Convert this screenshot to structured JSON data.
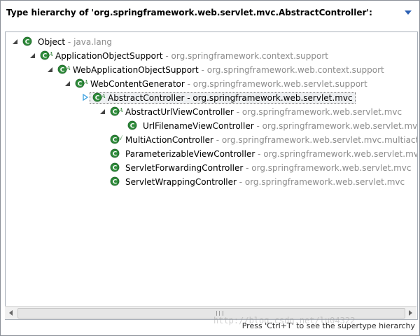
{
  "header": {
    "title": "Type hierarchy of 'org.springframework.web.servlet.mvc.AbstractController':"
  },
  "tree": [
    {
      "name": "Object",
      "package": "java.lang",
      "twisty": "expanded",
      "icon": "class-icon",
      "badge": ""
    },
    {
      "name": "ApplicationObjectSupport",
      "package": "org.springframework.context.support",
      "twisty": "expanded",
      "icon": "class-icon",
      "badge": "A"
    },
    {
      "name": "WebApplicationObjectSupport",
      "package": "org.springframework.web.context.support",
      "twisty": "expanded",
      "icon": "class-icon",
      "badge": "A"
    },
    {
      "name": "WebContentGenerator",
      "package": "org.springframework.web.servlet.support",
      "twisty": "expanded",
      "icon": "class-icon",
      "badge": "A"
    },
    {
      "name": "AbstractController",
      "package": "org.springframework.web.servlet.mvc",
      "twisty": "collapsed",
      "icon": "class-icon",
      "badge": "A",
      "selected": true
    },
    {
      "name": "AbstractUrlViewController",
      "package": "org.springframework.web.servlet.mvc",
      "twisty": "expanded",
      "icon": "class-icon",
      "badge": "A"
    },
    {
      "name": "UrlFilenameViewController",
      "package": "org.springframework.web.servlet.mvc",
      "twisty": "",
      "icon": "class-icon",
      "badge": ""
    },
    {
      "name": "MultiActionController",
      "package": "org.springframework.web.servlet.mvc.multiaction",
      "twisty": "",
      "icon": "class-icon",
      "badge": "√"
    },
    {
      "name": "ParameterizableViewController",
      "package": "org.springframework.web.servlet.mvc",
      "twisty": "",
      "icon": "class-icon",
      "badge": ""
    },
    {
      "name": "ServletForwardingController",
      "package": "org.springframework.web.servlet.mvc",
      "twisty": "",
      "icon": "class-icon",
      "badge": ""
    },
    {
      "name": "ServletWrappingController",
      "package": "org.springframework.web.servlet.mvc",
      "twisty": "",
      "icon": "class-icon",
      "badge": ""
    }
  ],
  "separator": " - ",
  "status": "Press 'Ctrl+T' to see the supertype hierarchy",
  "watermark": "http://blog.csdn.net/lu04322",
  "colors": {
    "class_icon": "#2e8b3a",
    "badge": "#2e7d32",
    "package_text": "#8c8c8c",
    "selection_twisty": "#3aa0e0"
  },
  "icons": {
    "view_menu": "triangle-down-icon",
    "twisty_expanded": "expanded-twisty-icon",
    "twisty_collapsed": "collapsed-twisty-icon",
    "scroll_left": "scroll-left-icon",
    "scroll_right": "scroll-right-icon"
  }
}
